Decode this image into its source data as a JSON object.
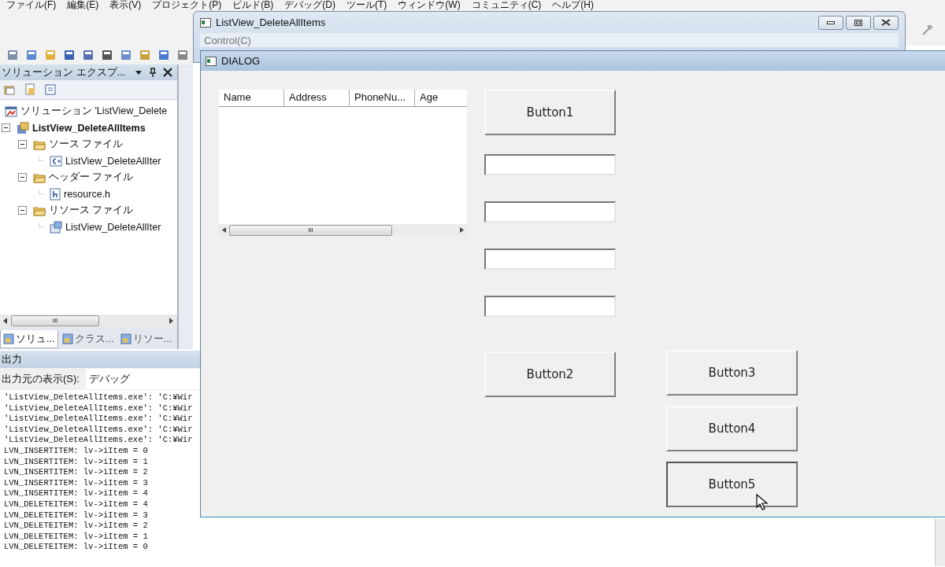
{
  "ide": {
    "menu": [
      "ファイル(F)",
      "編集(E)",
      "表示(V)",
      "プロジェクト(P)",
      "ビルド(B)",
      "デバッグ(D)",
      "ツール(T)",
      "ウィンドウ(W)",
      "コミュニティ(C)",
      "ヘルプ(H)"
    ],
    "solution_explorer": {
      "title": "ソリューション エクスプ...",
      "tree": [
        {
          "label": "ソリューション 'ListView_Delete",
          "kind": "solution",
          "children": [
            {
              "label": "ListView_DeleteAllItems",
              "kind": "project",
              "expanded": true,
              "children": [
                {
                  "label": "ソース ファイル",
                  "kind": "folder",
                  "expanded": true,
                  "children": [
                    {
                      "label": "ListView_DeleteAllIter",
                      "kind": "cpp"
                    }
                  ]
                },
                {
                  "label": "ヘッダー ファイル",
                  "kind": "folder",
                  "expanded": true,
                  "children": [
                    {
                      "label": "resource.h",
                      "kind": "header"
                    }
                  ]
                },
                {
                  "label": "リソース ファイル",
                  "kind": "folder",
                  "expanded": true,
                  "children": [
                    {
                      "label": "ListView_DeleteAllIter",
                      "kind": "resource"
                    }
                  ]
                }
              ]
            }
          ]
        }
      ],
      "scroll_mark": "III",
      "tabs": [
        {
          "label": "ソリュ...",
          "selected": true
        },
        {
          "label": "クラス...",
          "selected": false
        },
        {
          "label": "リソー...",
          "selected": false
        }
      ]
    },
    "output": {
      "title": "出力",
      "source_label": "出力元の表示(S):",
      "source": "デバッグ",
      "lines": [
        "'ListView_DeleteAllItems.exe': 'C:¥Wir",
        "'ListView_DeleteAllItems.exe': 'C:¥Wir",
        "'ListView_DeleteAllItems.exe': 'C:¥Wir",
        "'ListView_DeleteAllItems.exe': 'C:¥Wir",
        "'ListView_DeleteAllItems.exe': 'C:¥Wir",
        "LVN_INSERTITEM: lv->iItem = 0",
        "LVN_INSERTITEM: lv->iItem = 1",
        "LVN_INSERTITEM: lv->iItem = 2",
        "LVN_INSERTITEM: lv->iItem = 3",
        "LVN_INSERTITEM: lv->iItem = 4",
        "LVN_DELETEITEM: lv->iItem = 4",
        "LVN_DELETEITEM: lv->iItem = 3",
        "LVN_DELETEITEM: lv->iItem = 2",
        "LVN_DELETEITEM: lv->iItem = 1",
        "LVN_DELETEITEM: lv->iItem = 0"
      ]
    }
  },
  "app_window": {
    "title": "ListView_DeleteAllItems",
    "menu": [
      "Control(C)"
    ]
  },
  "dialog": {
    "title": "DIALOG",
    "list_columns": [
      "Name",
      "Address",
      "PhoneNu...",
      "Age"
    ],
    "list_scroll_mark": "III",
    "fields": [
      {
        "kind": "text"
      },
      {
        "kind": "text"
      },
      {
        "kind": "text"
      },
      {
        "kind": "text"
      }
    ],
    "buttons": [
      {
        "label": "Button1",
        "focused": false
      },
      {
        "label": "Button2",
        "focused": false
      },
      {
        "label": "Button3",
        "focused": false
      },
      {
        "label": "Button4",
        "focused": false
      },
      {
        "label": "Button5",
        "focused": true
      }
    ]
  }
}
